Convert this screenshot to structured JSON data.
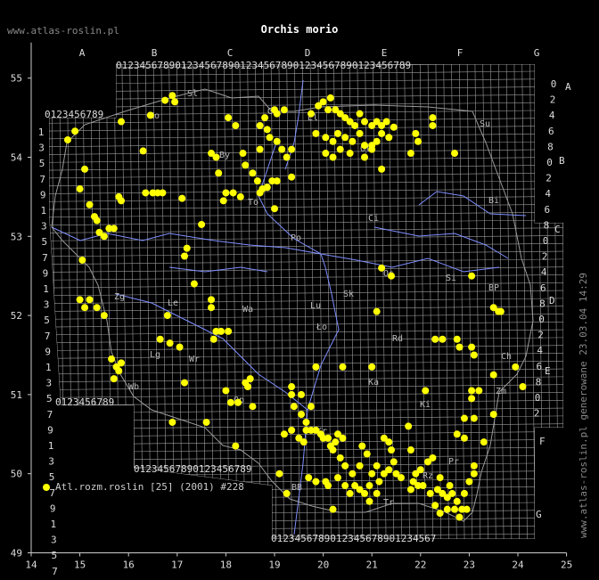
{
  "header": {
    "title": "Orchis morio",
    "site": "www.atlas-roslin.pl"
  },
  "side_note": "www.atlas-roslin.pl generowane 23.03.04 14:29",
  "legend": {
    "label": "Atl.rozm.roslin [25] (2001) #228",
    "color": "#ffff00"
  },
  "axes": {
    "lon_ticks": [
      "14",
      "15",
      "16",
      "17",
      "18",
      "19",
      "20",
      "21",
      "22",
      "23",
      "24",
      "25"
    ],
    "lat_ticks": [
      "49",
      "50",
      "51",
      "52",
      "53",
      "54",
      "55"
    ]
  },
  "grid": {
    "top_letters": [
      "A",
      "B",
      "C",
      "D",
      "E",
      "F",
      "G"
    ],
    "top_digits": "0123456789",
    "right_letters": [
      "A",
      "B",
      "C",
      "D",
      "E",
      "F",
      "G"
    ],
    "right_digits": "0246802468"
  },
  "regions": [
    "Sl",
    "Ko",
    "Gd",
    "El",
    "Ol",
    "Su",
    "By",
    "To",
    "Bi",
    "Ci",
    "Os",
    "Ło",
    "Sk",
    "Po",
    "Wa",
    "Le",
    "Zg",
    "Ka",
    "Rd",
    "Lu",
    "Kr",
    "Op",
    "Wb",
    "Wr",
    "Ki",
    "BP",
    "Ch",
    "Zm",
    "Pr",
    "Rz",
    "Tr",
    "BB",
    "Lg",
    "Si"
  ],
  "chart_data": {
    "type": "scatter",
    "xlabel": "",
    "ylabel": "",
    "xlim": [
      14,
      25
    ],
    "ylim": [
      49,
      55.5
    ],
    "series": [
      {
        "name": "Atl.rozm.roslin [25] (2001) #228",
        "points": [
          [
            14.75,
            54.22
          ],
          [
            14.9,
            54.33
          ],
          [
            15.85,
            54.45
          ],
          [
            16.45,
            54.53
          ],
          [
            16.75,
            54.72
          ],
          [
            16.9,
            54.78
          ],
          [
            16.95,
            54.7
          ],
          [
            15.0,
            53.6
          ],
          [
            15.1,
            53.85
          ],
          [
            15.2,
            53.4
          ],
          [
            15.3,
            53.25
          ],
          [
            15.35,
            53.2
          ],
          [
            15.4,
            53.05
          ],
          [
            15.5,
            53.0
          ],
          [
            15.6,
            53.1
          ],
          [
            15.7,
            53.1
          ],
          [
            15.8,
            53.5
          ],
          [
            15.85,
            53.45
          ],
          [
            16.35,
            53.55
          ],
          [
            16.5,
            53.55
          ],
          [
            16.6,
            53.55
          ],
          [
            16.7,
            53.55
          ],
          [
            17.1,
            53.48
          ],
          [
            16.3,
            54.08
          ],
          [
            17.5,
            53.15
          ],
          [
            17.2,
            52.85
          ],
          [
            17.15,
            52.75
          ],
          [
            17.35,
            52.4
          ],
          [
            18.05,
            54.5
          ],
          [
            18.2,
            54.4
          ],
          [
            18.35,
            54.05
          ],
          [
            18.4,
            53.9
          ],
          [
            18.55,
            53.8
          ],
          [
            18.65,
            53.7
          ],
          [
            18.7,
            53.55
          ],
          [
            18.75,
            53.6
          ],
          [
            18.85,
            53.62
          ],
          [
            18.95,
            53.7
          ],
          [
            19.05,
            53.7
          ],
          [
            19.0,
            53.35
          ],
          [
            18.7,
            54.1
          ],
          [
            18.7,
            54.4
          ],
          [
            18.8,
            54.5
          ],
          [
            18.85,
            54.35
          ],
          [
            18.9,
            54.25
          ],
          [
            19.0,
            54.6
          ],
          [
            19.05,
            54.55
          ],
          [
            19.2,
            54.6
          ],
          [
            19.05,
            54.2
          ],
          [
            19.15,
            54.1
          ],
          [
            19.25,
            54.0
          ],
          [
            19.35,
            53.75
          ],
          [
            19.35,
            54.1
          ],
          [
            17.7,
            54.05
          ],
          [
            17.8,
            54.0
          ],
          [
            17.85,
            53.8
          ],
          [
            18.0,
            53.55
          ],
          [
            17.95,
            53.45
          ],
          [
            18.15,
            53.55
          ],
          [
            18.3,
            53.5
          ],
          [
            19.75,
            54.55
          ],
          [
            19.9,
            54.65
          ],
          [
            20.0,
            54.7
          ],
          [
            20.1,
            54.6
          ],
          [
            20.15,
            54.75
          ],
          [
            20.25,
            54.6
          ],
          [
            20.35,
            54.55
          ],
          [
            20.45,
            54.5
          ],
          [
            20.55,
            54.45
          ],
          [
            20.65,
            54.4
          ],
          [
            20.75,
            54.55
          ],
          [
            20.85,
            54.45
          ],
          [
            21.0,
            54.4
          ],
          [
            21.1,
            54.45
          ],
          [
            21.2,
            54.4
          ],
          [
            21.3,
            54.45
          ],
          [
            21.45,
            54.38
          ],
          [
            19.85,
            54.3
          ],
          [
            20.05,
            54.25
          ],
          [
            20.2,
            54.2
          ],
          [
            20.3,
            54.3
          ],
          [
            20.45,
            54.25
          ],
          [
            20.6,
            54.2
          ],
          [
            20.75,
            54.3
          ],
          [
            20.85,
            54.15
          ],
          [
            21.0,
            54.1
          ],
          [
            21.1,
            54.2
          ],
          [
            21.2,
            54.3
          ],
          [
            21.35,
            54.25
          ],
          [
            20.05,
            54.05
          ],
          [
            20.2,
            54.0
          ],
          [
            20.35,
            54.1
          ],
          [
            20.55,
            54.05
          ],
          [
            20.85,
            54.0
          ],
          [
            21.0,
            54.15
          ],
          [
            21.8,
            54.05
          ],
          [
            21.9,
            54.3
          ],
          [
            21.95,
            54.2
          ],
          [
            22.25,
            54.4
          ],
          [
            22.25,
            54.5
          ],
          [
            22.7,
            54.05
          ],
          [
            21.2,
            53.85
          ],
          [
            21.2,
            52.6
          ],
          [
            21.4,
            52.5
          ],
          [
            23.05,
            52.5
          ],
          [
            15.05,
            52.7
          ],
          [
            15.0,
            52.2
          ],
          [
            15.1,
            52.1
          ],
          [
            15.2,
            52.2
          ],
          [
            15.35,
            52.1
          ],
          [
            15.5,
            52.0
          ],
          [
            16.8,
            52.0
          ],
          [
            16.65,
            51.7
          ],
          [
            16.85,
            51.65
          ],
          [
            17.05,
            51.6
          ],
          [
            17.7,
            52.2
          ],
          [
            17.7,
            52.1
          ],
          [
            17.8,
            51.8
          ],
          [
            17.9,
            51.8
          ],
          [
            18.05,
            51.8
          ],
          [
            17.75,
            51.7
          ],
          [
            15.65,
            51.45
          ],
          [
            15.75,
            51.35
          ],
          [
            15.85,
            51.4
          ],
          [
            15.7,
            51.2
          ],
          [
            15.8,
            51.3
          ],
          [
            17.15,
            51.15
          ],
          [
            16.9,
            50.65
          ],
          [
            17.6,
            50.65
          ],
          [
            18.0,
            51.05
          ],
          [
            18.1,
            50.9
          ],
          [
            18.25,
            50.9
          ],
          [
            18.45,
            51.1
          ],
          [
            18.5,
            51.2
          ],
          [
            18.55,
            50.85
          ],
          [
            18.2,
            50.35
          ],
          [
            19.35,
            51.1
          ],
          [
            19.35,
            51.0
          ],
          [
            19.4,
            50.85
          ],
          [
            19.55,
            51.0
          ],
          [
            19.55,
            50.75
          ],
          [
            19.65,
            50.65
          ],
          [
            19.75,
            50.85
          ],
          [
            19.85,
            51.35
          ],
          [
            19.75,
            50.55
          ],
          [
            19.85,
            50.55
          ],
          [
            19.95,
            50.5
          ],
          [
            19.6,
            50.4
          ],
          [
            19.65,
            50.55
          ],
          [
            19.5,
            50.45
          ],
          [
            20.0,
            50.45
          ],
          [
            20.1,
            50.45
          ],
          [
            20.15,
            50.35
          ],
          [
            20.25,
            50.4
          ],
          [
            20.3,
            50.5
          ],
          [
            20.4,
            50.45
          ],
          [
            20.2,
            50.3
          ],
          [
            20.35,
            50.2
          ],
          [
            20.45,
            50.1
          ],
          [
            20.6,
            50.0
          ],
          [
            20.75,
            50.1
          ],
          [
            20.8,
            50.35
          ],
          [
            20.9,
            50.25
          ],
          [
            21.0,
            50.0
          ],
          [
            21.1,
            50.1
          ],
          [
            21.15,
            49.9
          ],
          [
            21.25,
            50.0
          ],
          [
            21.35,
            50.05
          ],
          [
            21.45,
            50.15
          ],
          [
            21.5,
            50.0
          ],
          [
            21.6,
            49.95
          ],
          [
            21.25,
            50.45
          ],
          [
            21.35,
            50.4
          ],
          [
            21.4,
            50.3
          ],
          [
            21.8,
            50.3
          ],
          [
            21.8,
            49.8
          ],
          [
            21.9,
            50.0
          ],
          [
            22.0,
            50.05
          ],
          [
            22.15,
            50.15
          ],
          [
            22.25,
            50.2
          ],
          [
            19.7,
            49.95
          ],
          [
            19.85,
            49.9
          ],
          [
            20.05,
            49.9
          ],
          [
            20.1,
            49.85
          ],
          [
            20.3,
            49.95
          ],
          [
            20.45,
            49.85
          ],
          [
            20.55,
            49.75
          ],
          [
            20.65,
            49.85
          ],
          [
            20.75,
            49.8
          ],
          [
            20.85,
            49.75
          ],
          [
            20.95,
            49.85
          ],
          [
            21.1,
            49.75
          ],
          [
            20.2,
            49.55
          ],
          [
            20.95,
            49.65
          ],
          [
            21.85,
            49.9
          ],
          [
            21.95,
            49.85
          ],
          [
            22.05,
            49.85
          ],
          [
            22.2,
            49.75
          ],
          [
            22.35,
            49.8
          ],
          [
            22.45,
            49.75
          ],
          [
            22.55,
            49.7
          ],
          [
            22.65,
            49.75
          ],
          [
            22.75,
            49.65
          ],
          [
            22.85,
            49.55
          ],
          [
            22.95,
            49.55
          ],
          [
            22.3,
            49.6
          ],
          [
            22.4,
            49.5
          ],
          [
            22.55,
            49.55
          ],
          [
            22.7,
            49.55
          ],
          [
            22.8,
            49.45
          ],
          [
            22.4,
            49.95
          ],
          [
            22.6,
            49.85
          ],
          [
            22.9,
            49.75
          ],
          [
            23.0,
            49.9
          ],
          [
            23.1,
            50.0
          ],
          [
            23.1,
            50.1
          ],
          [
            22.75,
            50.5
          ],
          [
            22.9,
            50.45
          ],
          [
            19.25,
            49.75
          ],
          [
            19.1,
            50.0
          ],
          [
            19.2,
            50.5
          ],
          [
            19.35,
            50.55
          ],
          [
            22.3,
            51.7
          ],
          [
            22.45,
            51.7
          ],
          [
            22.75,
            51.7
          ],
          [
            22.8,
            51.6
          ],
          [
            23.05,
            51.6
          ],
          [
            23.1,
            51.5
          ],
          [
            23.05,
            51.05
          ],
          [
            23.2,
            51.05
          ],
          [
            23.5,
            51.25
          ],
          [
            23.95,
            51.35
          ],
          [
            24.1,
            51.1
          ],
          [
            23.05,
            50.95
          ],
          [
            22.9,
            50.7
          ],
          [
            23.1,
            50.7
          ],
          [
            23.5,
            50.75
          ],
          [
            23.3,
            50.4
          ],
          [
            23.5,
            52.1
          ],
          [
            23.6,
            52.05
          ],
          [
            23.65,
            52.05
          ],
          [
            21.1,
            52.05
          ],
          [
            22.1,
            51.05
          ],
          [
            21.75,
            50.6
          ],
          [
            21.0,
            51.35
          ],
          [
            20.4,
            51.35
          ],
          [
            18.4,
            51.15
          ]
        ]
      }
    ]
  }
}
